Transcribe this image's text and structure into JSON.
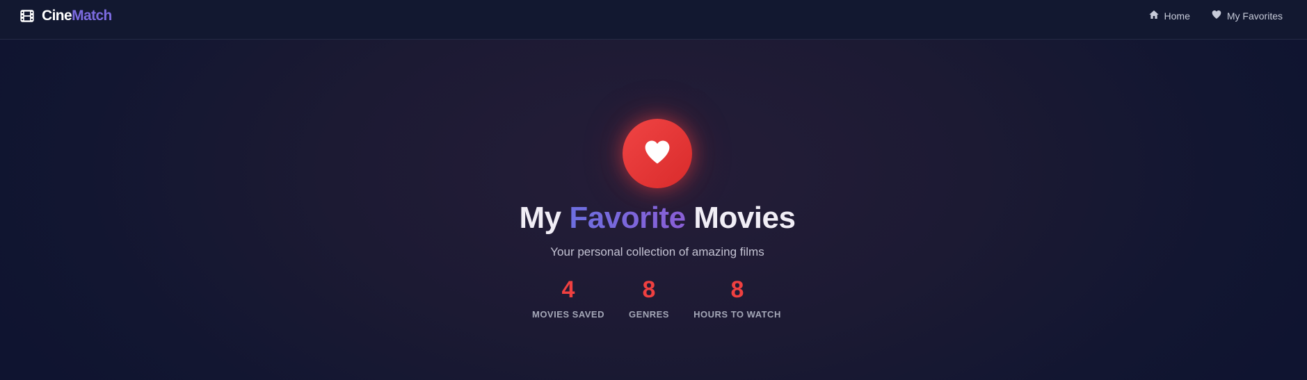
{
  "nav": {
    "brand_part1": "Cine",
    "brand_part2": "Match",
    "brand_icon": "film-icon",
    "links": [
      {
        "label": "Home",
        "icon": "home-icon"
      },
      {
        "label": "My Favorites",
        "icon": "heart-icon"
      }
    ]
  },
  "hero": {
    "icon": "heart-icon",
    "title_part1": "My",
    "title_accent": "Favorite",
    "title_part2": "Movies",
    "subtitle": "Your personal collection of amazing films"
  },
  "stats": [
    {
      "value": "4",
      "label": "MOVIES SAVED"
    },
    {
      "value": "8",
      "label": "GENRES"
    },
    {
      "value": "8",
      "label": "HOURS TO WATCH"
    }
  ],
  "colors": {
    "accent": "#7c6be0",
    "heart": "#ef4444",
    "background": "#121631"
  }
}
